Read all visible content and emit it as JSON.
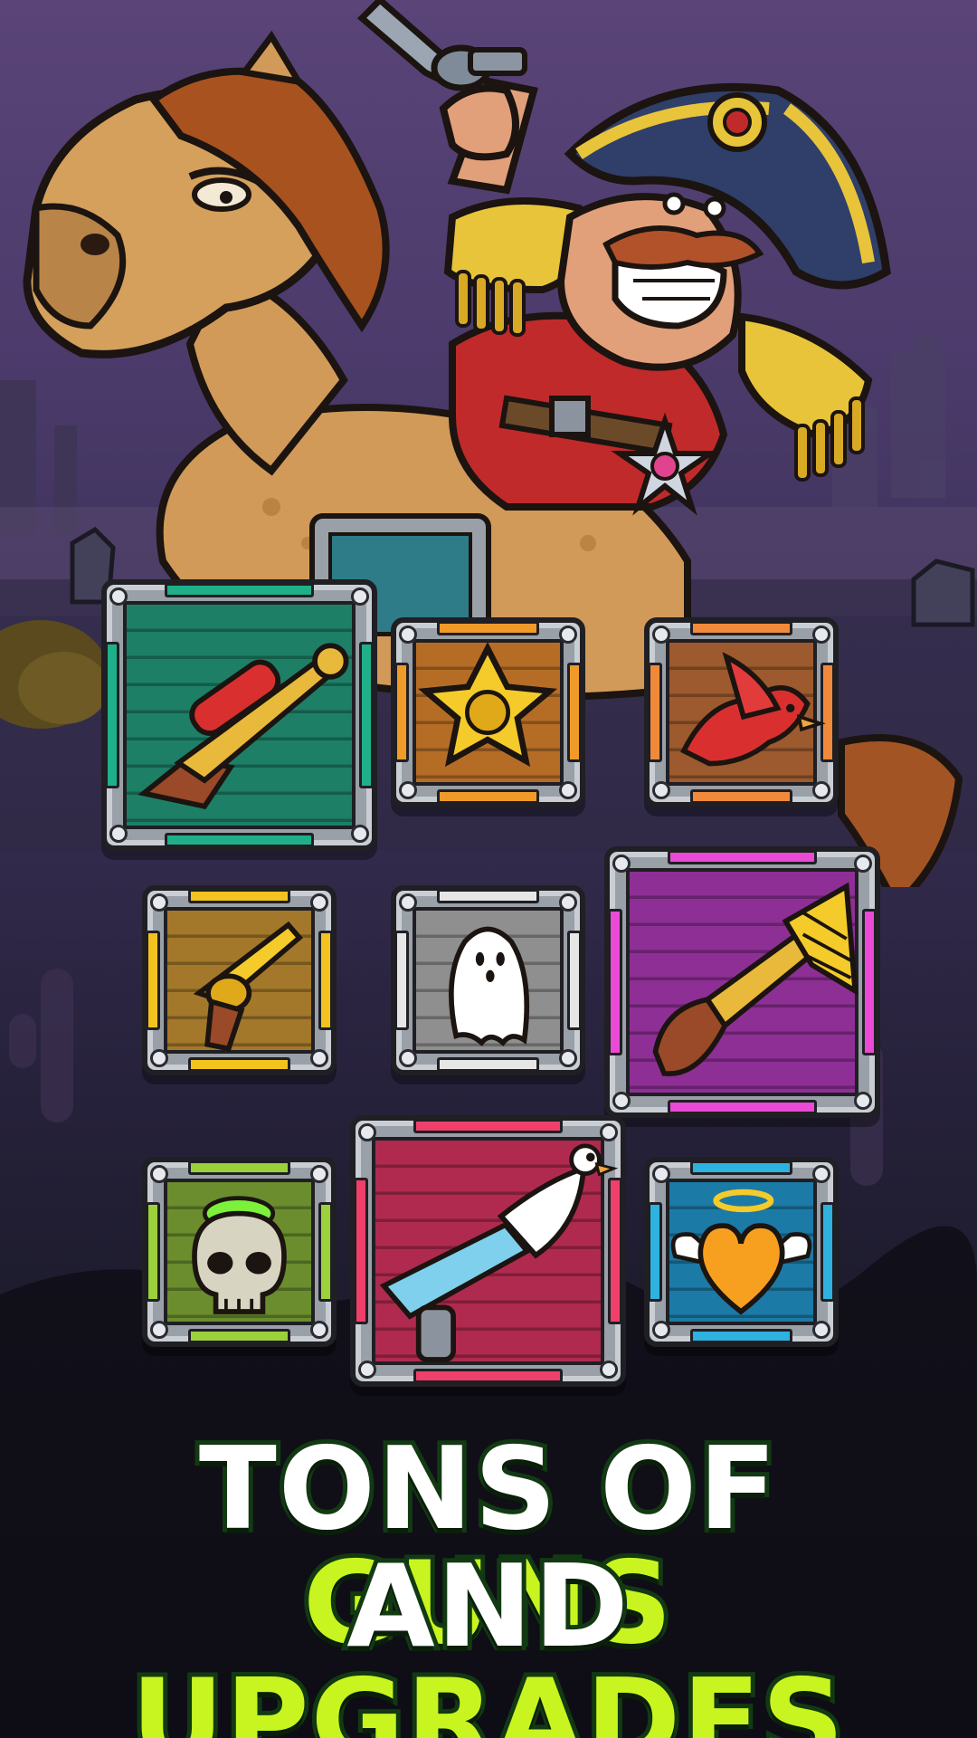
{
  "promo": {
    "headline_line1_white": "TONS OF",
    "headline_line1_lime": "GUNS",
    "headline_line2_white": "AND",
    "headline_line2_lime": "UPGRADES"
  },
  "colors": {
    "sky_top": "#5a4478",
    "ground_dark": "#0b0b12",
    "headline_white": "#ffffff",
    "headline_lime": "#c8f51f",
    "headline_outline": "#123a12"
  },
  "crates": [
    {
      "item": "water-blaster-rifle-icon",
      "accent": "#1fb08a",
      "panel": "#1d7f66"
    },
    {
      "item": "sheriff-star-icon",
      "accent": "#f09a2a",
      "panel": "#b56d26"
    },
    {
      "item": "red-cardinal-bird-icon",
      "accent": "#f08a3a",
      "panel": "#9c5a2e"
    },
    {
      "item": "golden-revolver-icon",
      "accent": "#f2c21f",
      "panel": "#a3782a"
    },
    {
      "item": "ghost-icon",
      "accent": "#e6e6e6",
      "panel": "#8f8f8f"
    },
    {
      "item": "trumpet-flintlock-icon",
      "accent": "#ea4ad6",
      "panel": "#8e2f95"
    },
    {
      "item": "green-skull-icon",
      "accent": "#9bd13a",
      "panel": "#6b8d2e"
    },
    {
      "item": "chicken-raygun-icon",
      "accent": "#ef3f6a",
      "panel": "#b02a4f"
    },
    {
      "item": "winged-heart-halo-icon",
      "accent": "#2eb2e0",
      "panel": "#1c7aa6"
    }
  ]
}
